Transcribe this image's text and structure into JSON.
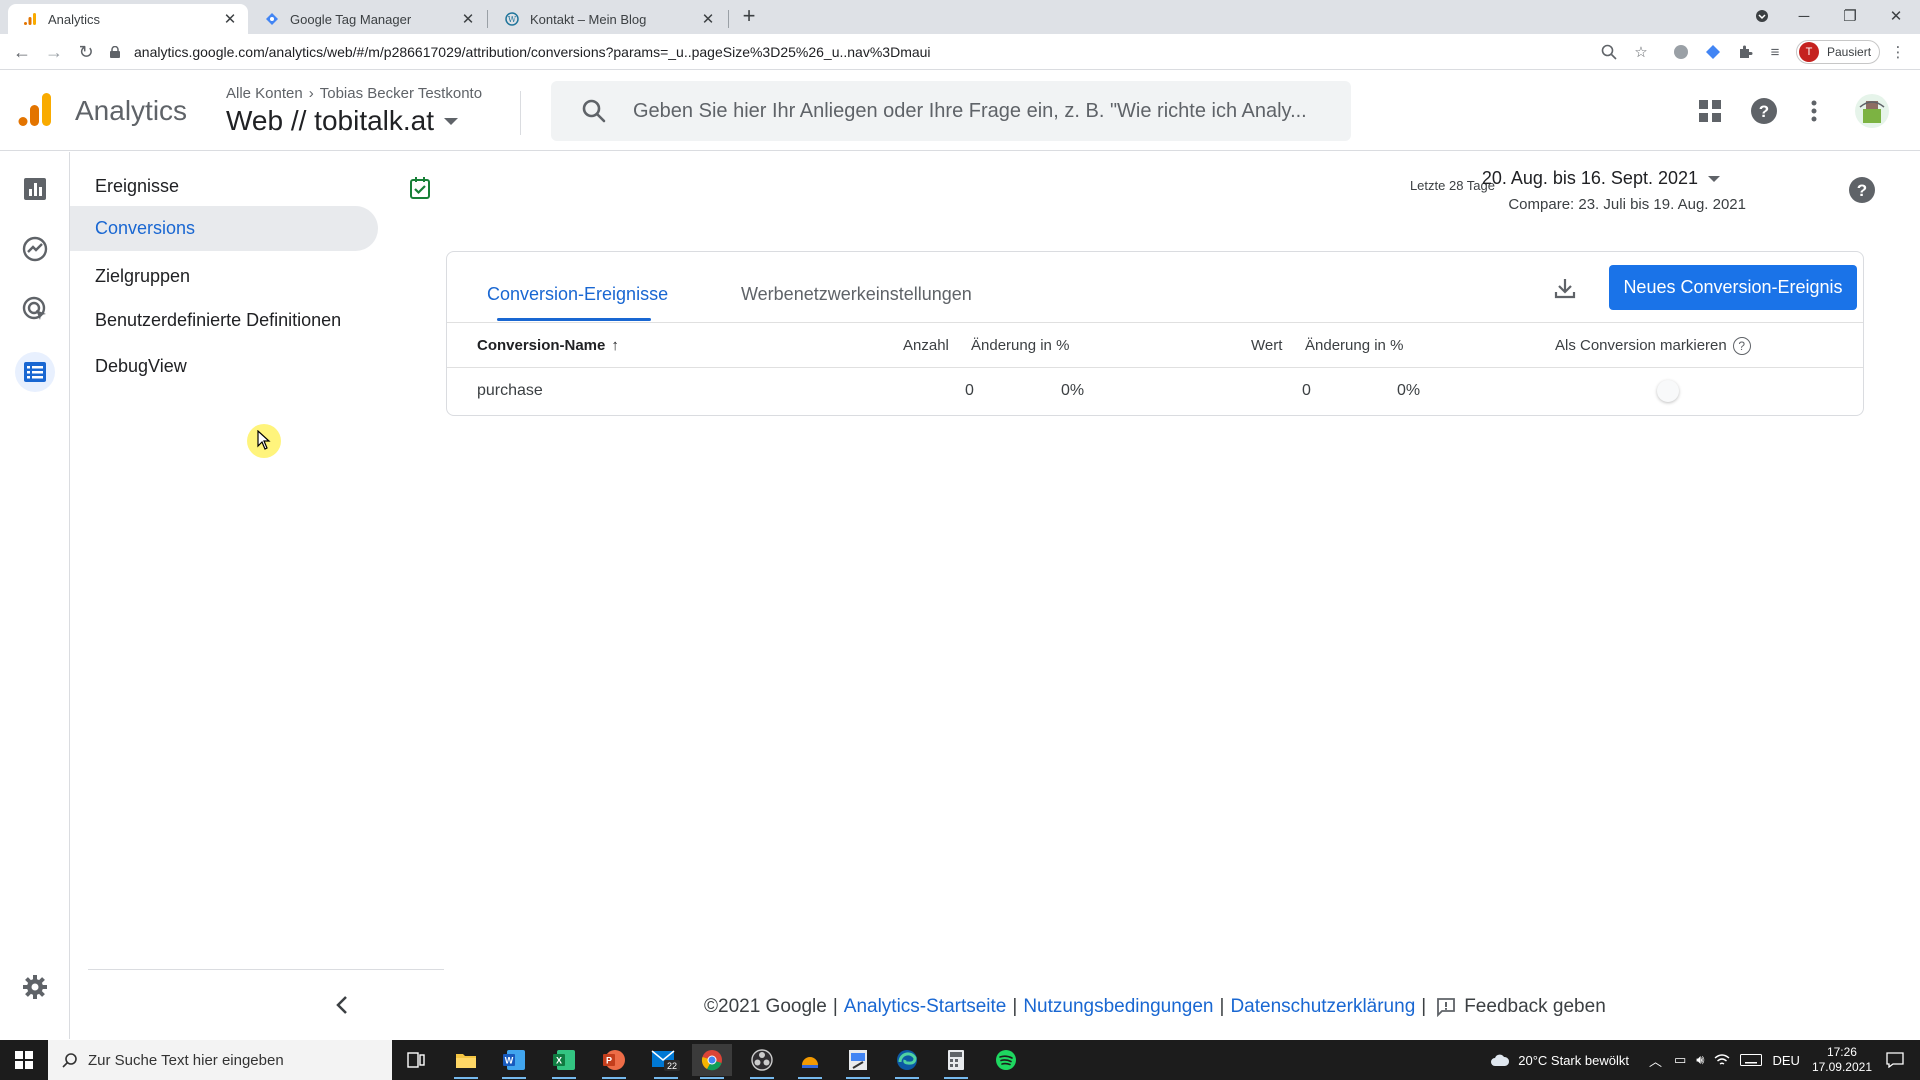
{
  "browser": {
    "tabs": [
      {
        "title": "Analytics",
        "icon": "analytics-favicon",
        "active": true
      },
      {
        "title": "Google Tag Manager",
        "icon": "tag-manager-favicon",
        "active": false
      },
      {
        "title": "Kontakt – Mein Blog",
        "icon": "wordpress-favicon",
        "active": false
      }
    ],
    "url": "analytics.google.com/analytics/web/#/m/p286617029/attribution/conversions?params=_u..pageSize%3D25%26_u..nav%3Dmaui",
    "profile_initial": "T",
    "profile_status": "Pausiert"
  },
  "header": {
    "product": "Analytics",
    "breadcrumb_root": "Alle Konten",
    "breadcrumb_account": "Tobias Becker Testkonto",
    "property": "Web // tobitalk.at",
    "search_placeholder": "Geben Sie hier Ihr Anliegen oder Ihre Frage ein, z. B. \"Wie richte ich Analy..."
  },
  "sidebar": {
    "items": [
      {
        "label": "Ereignisse",
        "active": false
      },
      {
        "label": "Conversions",
        "active": true
      },
      {
        "label": "Zielgruppen",
        "active": false
      },
      {
        "label": "Benutzerdefinierte Definitionen",
        "active": false
      },
      {
        "label": "DebugView",
        "active": false
      }
    ]
  },
  "date_range": {
    "label": "Letzte 28 Tage",
    "value": "20. Aug. bis 16. Sept. 2021",
    "compare": "Compare: 23. Juli bis 19. Aug. 2021"
  },
  "card": {
    "tabs": [
      {
        "label": "Conversion-Ereignisse",
        "active": true
      },
      {
        "label": "Werbenetzwerkeinstellungen",
        "active": false
      }
    ],
    "new_button": "Neues Conversion-Ereignis",
    "columns": {
      "name": "Conversion-Name",
      "count": "Anzahl",
      "count_change": "Änderung in %",
      "value": "Wert",
      "value_change": "Änderung in %",
      "mark": "Als Conversion markieren"
    },
    "rows": [
      {
        "name": "purchase",
        "count": "0",
        "count_change": "0%",
        "value": "0",
        "value_change": "0%",
        "marked": false
      }
    ]
  },
  "footer": {
    "copyright": "©2021 Google",
    "links": [
      "Analytics-Startseite",
      "Nutzungsbedingungen",
      "Datenschutzerklärung"
    ],
    "feedback": "Feedback geben"
  },
  "taskbar": {
    "search_placeholder": "Zur Suche Text hier eingeben",
    "mail_badge": "22",
    "weather": "20°C  Stark bewölkt",
    "language": "DEU",
    "time": "17:26",
    "date": "17.09.2021"
  },
  "colors": {
    "accent": "#1a73e8",
    "active_text": "#1967d2",
    "ga_orange": "#f9ab00",
    "ga_dark_orange": "#e37400"
  }
}
